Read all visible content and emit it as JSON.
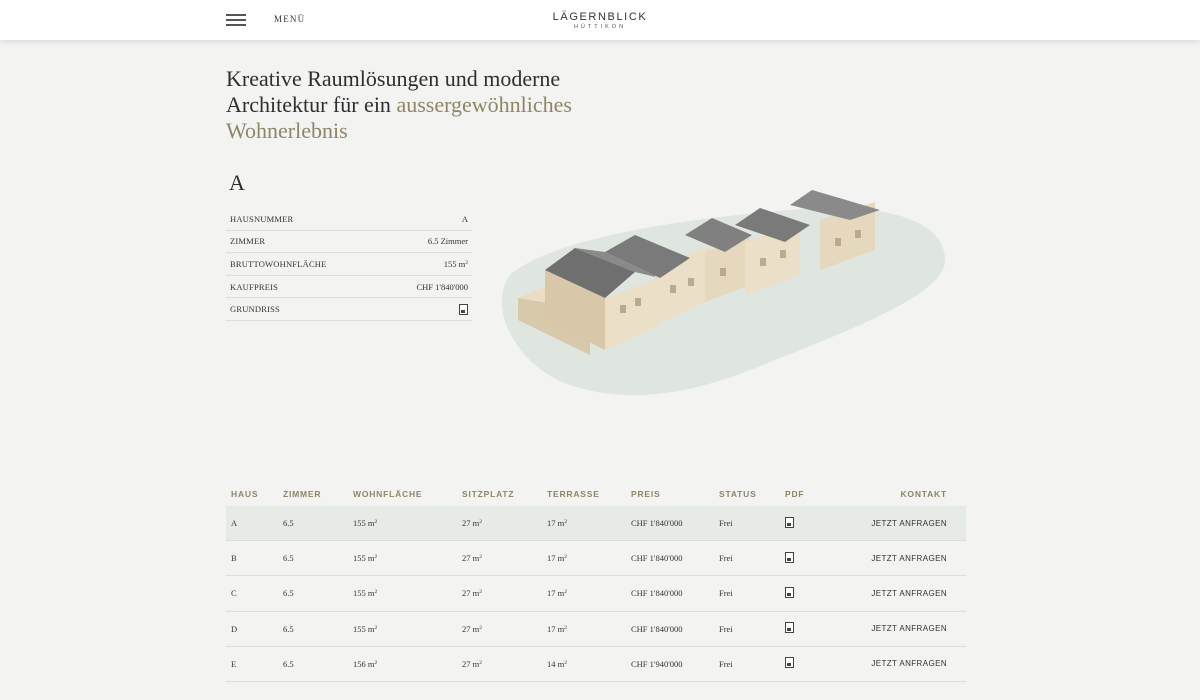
{
  "header": {
    "menu_label": "MENÜ",
    "logo_main": "LÄGERNBLICK",
    "logo_sub": "HÜTTIKON"
  },
  "headline": {
    "line1": "Kreative Raumlösungen und moderne",
    "line2_a": "Architektur für ein ",
    "line2_b": "aussergewöhnliches",
    "line3": "Wohnerlebnis"
  },
  "detail": {
    "letter": "A",
    "rows": [
      {
        "label": "HAUSNUMMER",
        "value": "A"
      },
      {
        "label": "ZIMMER",
        "value": "6.5 Zimmer"
      },
      {
        "label": "BRUTTOWOHNFLÄCHE",
        "value": "155 m"
      },
      {
        "label": "KAUFPREIS",
        "value": "CHF 1'840'000"
      },
      {
        "label": "GRUNDRISS",
        "value": ""
      }
    ],
    "area_unit_sup": "2"
  },
  "listing": {
    "headers": {
      "haus": "HAUS",
      "zimmer": "ZIMMER",
      "wohnflaeche": "WOHNFLÄCHE",
      "sitzplatz": "SITZPLATZ",
      "terrasse": "TERRASSE",
      "preis": "PREIS",
      "status": "STATUS",
      "pdf": "PDF",
      "kontakt": "KONTAKT"
    },
    "rows": [
      {
        "haus": "A",
        "zimmer": "6.5",
        "wohn": "155 m",
        "sitz": "27 m",
        "terr": "17 m",
        "preis": "CHF 1'840'000",
        "status": "Frei",
        "kontakt": "JETZT ANFRAGEN"
      },
      {
        "haus": "B",
        "zimmer": "6.5",
        "wohn": "155 m",
        "sitz": "27 m",
        "terr": "17 m",
        "preis": "CHF 1'840'000",
        "status": "Frei",
        "kontakt": "JETZT ANFRAGEN"
      },
      {
        "haus": "C",
        "zimmer": "6.5",
        "wohn": "155 m",
        "sitz": "27 m",
        "terr": "17 m",
        "preis": "CHF 1'840'000",
        "status": "Frei",
        "kontakt": "JETZT ANFRAGEN"
      },
      {
        "haus": "D",
        "zimmer": "6.5",
        "wohn": "155 m",
        "sitz": "27 m",
        "terr": "17 m",
        "preis": "CHF 1'840'000",
        "status": "Frei",
        "kontakt": "JETZT ANFRAGEN"
      },
      {
        "haus": "E",
        "zimmer": "6.5",
        "wohn": "156 m",
        "sitz": "27 m",
        "terr": "14 m",
        "preis": "CHF 1'940'000",
        "status": "Frei",
        "kontakt": "JETZT ANFRAGEN"
      }
    ],
    "unit_sup": "2"
  },
  "colors": {
    "accent": "#8f8566",
    "active_row": "#e6ebe6",
    "background": "#f3f3f2"
  }
}
